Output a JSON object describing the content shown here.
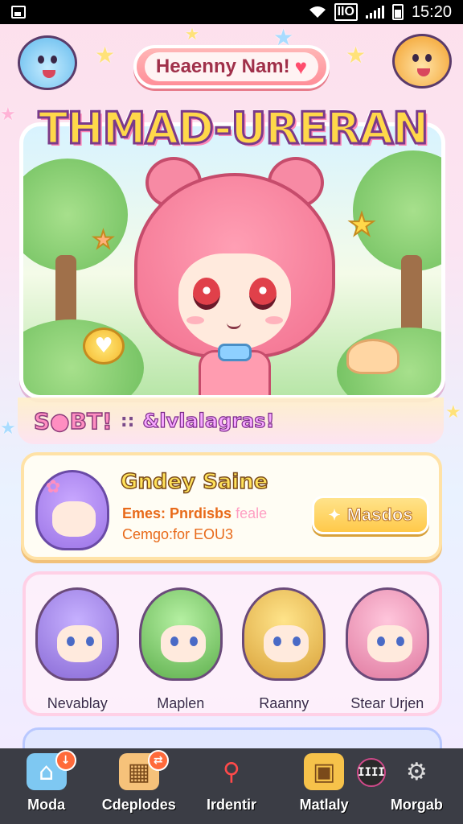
{
  "status_bar": {
    "time": "15:20"
  },
  "header": {
    "username": "Heaenny Nam!",
    "game_title": "THMAD-URERAN"
  },
  "ribbon": {
    "left_text": "S●BT!",
    "separator": "::",
    "right_text": "&lvlalagras!"
  },
  "profile": {
    "player_name": "Gndey Saine",
    "line1_main": "Emes: Pnrdisbs",
    "line1_faded": "feale",
    "line2": "Cemgo:for EOU3",
    "action_label": "Masdos"
  },
  "roster": [
    {
      "name": "Nevablay",
      "hair": "#a98bee",
      "accent": "#8a6bd6"
    },
    {
      "name": "Maplen",
      "hair": "#8fdc7a",
      "accent": "#5fb04e"
    },
    {
      "name": "Raanny",
      "hair": "#ffd05a",
      "accent": "#d9a23a"
    },
    {
      "name": "Stear Urjen",
      "hair": "#ffa6c8",
      "accent": "#e07aa0"
    }
  ],
  "nav": [
    {
      "label": "Moda",
      "icon": "home-icon",
      "badge": "↓"
    },
    {
      "label": "Cdeplodes",
      "icon": "shop-icon",
      "badge": "⇄"
    },
    {
      "label": "Irdentir",
      "icon": "search-icon",
      "badge": ""
    },
    {
      "label": "Matlaly",
      "icon": "gift-icon",
      "badge": ""
    },
    {
      "label": "Morgab",
      "icon": "settings-icon",
      "badge": ""
    }
  ],
  "extra_icon_text": "IIII",
  "colors": {
    "accent_pink": "#ff8fa0",
    "title_yellow": "#ffd84a",
    "nav_bg": "#3b3d45"
  }
}
